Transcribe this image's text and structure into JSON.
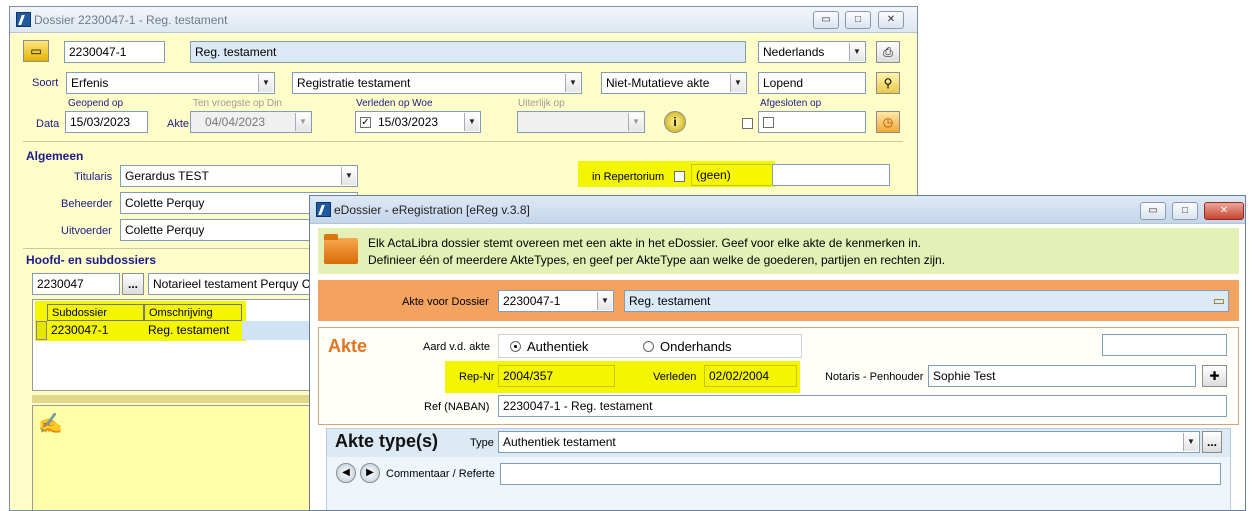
{
  "back": {
    "title": "Dossier 2230047-1 - Reg. testament",
    "dossier_nr": "2230047-1",
    "omschrijving": "Reg. testament",
    "language": "Nederlands",
    "soort_label": "Soort",
    "soort": "Erfenis",
    "type": "Registratie testament",
    "akte_kind": "Niet-Mutatieve akte",
    "status": "Lopend",
    "labels": {
      "geopend": "Geopend op",
      "ten_vroegste": "Ten vroegste op Din",
      "verleden": "Verleden op Woe",
      "uiterlijk": "Uiterlijk op",
      "afgesloten": "Afgesloten op",
      "data": "Data",
      "akte": "Akte"
    },
    "dates": {
      "geopend": "15/03/2023",
      "ten_vroegste": "04/04/2023",
      "verleden": "15/03/2023"
    },
    "algemeen": {
      "title": "Algemeen",
      "titularis_label": "Titularis",
      "titularis": "Gerardus TEST",
      "beheerder_label": "Beheerder",
      "beheerder": "Colette Perquy",
      "uitvoerder_label": "Uitvoerder",
      "uitvoerder": "Colette Perquy",
      "repertorium_label": "in Repertorium",
      "repertorium_value": "(geen)"
    },
    "sub": {
      "title": "Hoofd- en subdossiers",
      "hoofd_nr": "2230047",
      "hoofd_desc": "Notarieel testament Perquy C",
      "ellipsis": "...",
      "col1": "Subdossier",
      "col2": "Omschrijving",
      "row_nr": "2230047-1",
      "row_desc": "Reg. testament"
    }
  },
  "front": {
    "title": "eDossier - eRegistration [eReg v.3.8]",
    "info_line1": "Elk ActaLibra dossier stemt overeen met een akte in het eDossier. Geef voor elke akte de kenmerken in.",
    "info_line2": "Definieer één of meerdere AkteTypes, en geef per AkteType aan welke de goederen, partijen en rechten zijn.",
    "akte_voor_label": "Akte voor Dossier",
    "akte_voor_nr": "2230047-1",
    "akte_voor_desc": "Reg. testament",
    "akte_title": "Akte",
    "aard_label": "Aard v.d. akte",
    "opt_authentiek": "Authentiek",
    "opt_onderhands": "Onderhands",
    "repnr_label": "Rep-Nr",
    "repnr": "2004/357",
    "verleden_label": "Verleden",
    "verleden": "02/02/2004",
    "notaris_label": "Notaris - Penhouder",
    "notaris": "Sophie Test",
    "ref_label": "Ref (NABAN)",
    "ref": "2230047-1 - Reg. testament",
    "types_title": "Akte type(s)",
    "type_label": "Type",
    "type_value": "Authentiek testament",
    "type_ellipsis": "...",
    "comment_label": "Commentaar / Referte"
  },
  "colors": {
    "orange": "#f4a25f",
    "highlight": "#f4f500",
    "info_bg": "#e3f0b6"
  }
}
